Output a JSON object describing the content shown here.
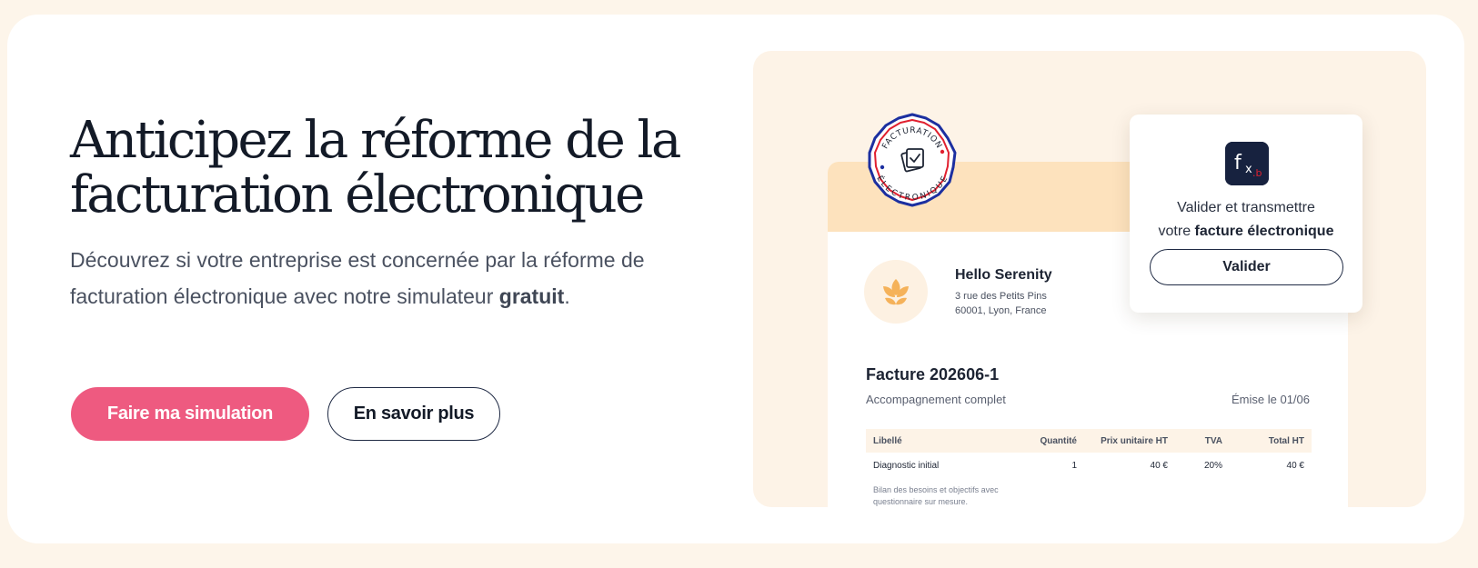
{
  "hero": {
    "title_line1": "Anticipez la réforme de la",
    "title_line2": "facturation électronique",
    "description": "Découvrez si votre entreprise est concernée par la réforme de facturation électronique avec notre simulateur",
    "description_bold": "gratuit",
    "description_end": ".",
    "primary_button": "Faire ma simulation",
    "secondary_button": "En savoir plus"
  },
  "seal": {
    "top_text": "FACTURATION",
    "bottom_text": "ÉLECTRONIQUE",
    "icon": "checked-document-icon"
  },
  "invoice": {
    "company_name": "Hello Serenity",
    "address_line1": "3 rue des Petits Pins",
    "address_line2": "60001, Lyon, France",
    "number": "Facture 202606-1",
    "service": "Accompagnement complet",
    "date": "Émise le 01/06",
    "columns": [
      "Libellé",
      "Quantité",
      "Prix unitaire HT",
      "TVA",
      "Total HT"
    ],
    "rows": [
      [
        "Diagnostic initial",
        "1",
        "40 €",
        "20%",
        "40 €"
      ]
    ],
    "item_description_line1": "Bilan des besoins et objectifs avec",
    "item_description_line2": "questionnaire sur mesure."
  },
  "validation": {
    "badge_main": "f",
    "badge_sub": "x",
    "badge_dot": ".b",
    "line1": "Valider et transmettre",
    "line2_prefix": "votre ",
    "line2_bold": "facture électronique",
    "button": "Valider"
  },
  "colors": {
    "page_background": "#fdf5ea",
    "primary_button": "#ee5a80",
    "seal_blue": "#1c2fa0",
    "seal_red": "#e0202f",
    "invoice_band": "#fde2bd",
    "logo_accent": "#f5b25a",
    "badge_navy": "#17223f"
  }
}
